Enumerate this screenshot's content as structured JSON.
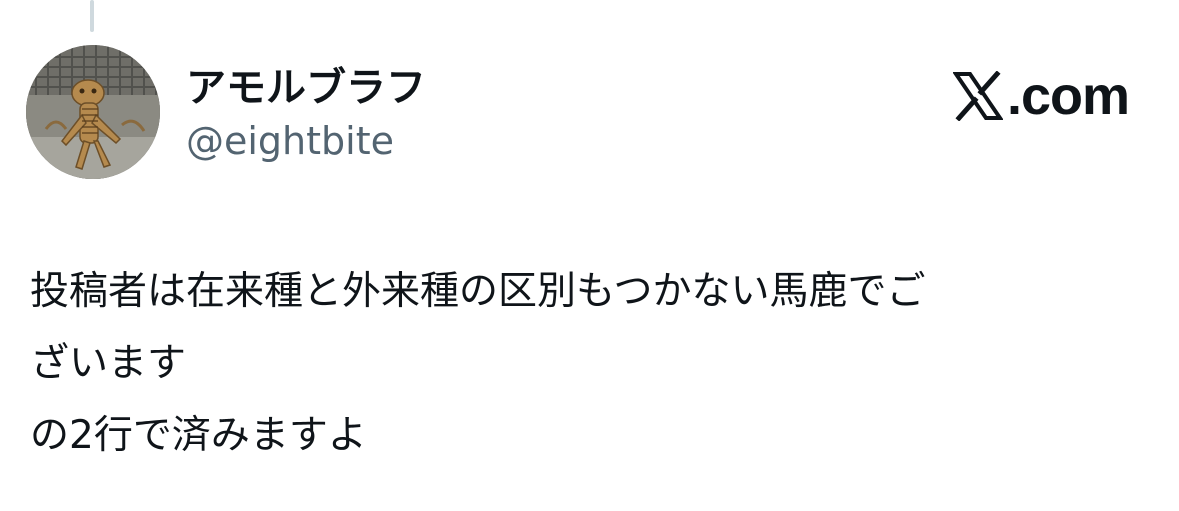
{
  "author": {
    "display_name": "アモルブラフ",
    "handle": "@eightbite"
  },
  "brand": {
    "text": ".com",
    "icon": "x-logo-icon"
  },
  "tweet": {
    "lines": [
      "投稿者は在来種と外来種の区別もつかない馬鹿でご",
      "ざいます",
      "の2行で済みますよ"
    ]
  },
  "colors": {
    "text_primary": "#0f1419",
    "text_secondary": "#536471",
    "thread_line": "#cfd9de",
    "background": "#ffffff"
  }
}
